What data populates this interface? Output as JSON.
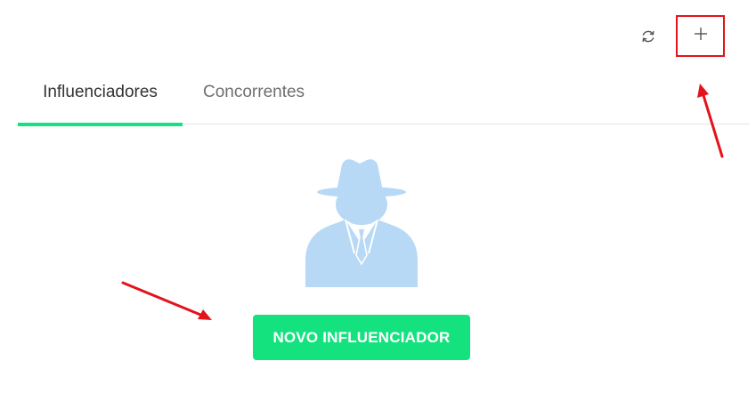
{
  "toolbar": {
    "refresh_icon": "refresh-icon",
    "add_icon": "plus-icon",
    "highlight_color": "#e3131b"
  },
  "tabs": [
    {
      "label": "Influenciadores",
      "active": true
    },
    {
      "label": "Concorrentes",
      "active": false
    }
  ],
  "empty_state": {
    "illustration_icon": "spy-agent-icon",
    "button_label": "NOVO INFLUENCIADOR"
  },
  "colors": {
    "accent": "#14e27f",
    "illustration": "#b7d9f6",
    "annotation_red": "#e3131b"
  }
}
